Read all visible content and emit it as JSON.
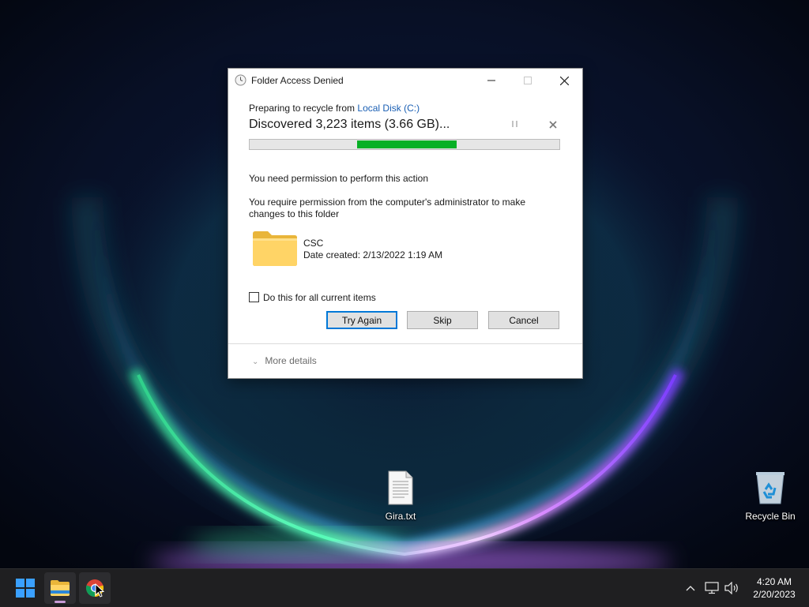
{
  "dialog": {
    "title": "Folder Access Denied",
    "minimize_icon": "minimize-icon",
    "maximize_icon": "maximize-icon",
    "close_icon": "close-icon",
    "preparing_prefix": "Preparing to recycle from ",
    "preparing_link": "Local Disk (C:)",
    "discovered": "Discovered 3,223 items (3.66 GB)...",
    "progress": 0.3,
    "progress_color": "#06b025",
    "need_permission": "You need permission to perform this action",
    "require_permission": "You require permission from the computer's administrator to make changes to this folder",
    "folder": {
      "name": "CSC",
      "date_created": "Date created: 2/13/2022 1:19 AM"
    },
    "checkbox_label": "Do this for all current items",
    "checkbox_checked": false,
    "buttons": {
      "try_again": "Try Again",
      "skip": "Skip",
      "cancel": "Cancel"
    },
    "more_details": "More details"
  },
  "desktop": {
    "icons": [
      {
        "label": "Gira.txt",
        "icon": "text-file-icon"
      },
      {
        "label": "Recycle Bin",
        "icon": "recycle-bin-icon"
      }
    ]
  },
  "taskbar": {
    "apps": [
      "start-icon",
      "file-explorer-icon",
      "chrome-icon"
    ],
    "tray_icons": [
      "chevron-up-icon",
      "network-icon",
      "volume-icon"
    ],
    "time": "4:20 AM",
    "date": "2/20/2023"
  }
}
